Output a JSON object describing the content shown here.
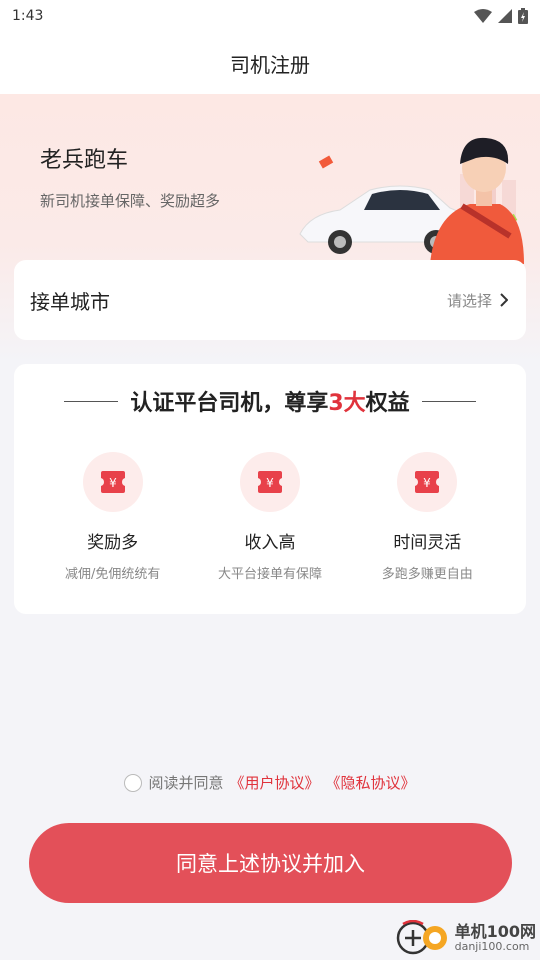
{
  "status_bar": {
    "time": "1:43"
  },
  "nav": {
    "title": "司机注册"
  },
  "hero": {
    "title": "老兵跑车",
    "subtitle": "新司机接单保障、奖励超多"
  },
  "city": {
    "label": "接单城市",
    "placeholder": "请选择"
  },
  "benefits": {
    "title_pre": "认证平台司机，尊享",
    "title_highlight": "3大",
    "title_post": "权益",
    "items": [
      {
        "icon": "yuan-coupon-icon",
        "name": "奖励多",
        "desc": "减佣/免佣统统有"
      },
      {
        "icon": "yuan-coupon-icon",
        "name": "收入高",
        "desc": "大平台接单有保障"
      },
      {
        "icon": "yuan-coupon-icon",
        "name": "时间灵活",
        "desc": "多跑多赚更自由"
      }
    ]
  },
  "agreement": {
    "prefix": "阅读并同意",
    "user_link": "《用户协议》",
    "privacy_link": "《隐私协议》"
  },
  "primary_button": {
    "label": "同意上述协议并加入"
  },
  "watermark": {
    "main": "单机100网",
    "sub": "danji100.com"
  },
  "colors": {
    "accent": "#e0333c",
    "button": "#e35059",
    "icon_bg": "#fdeceb"
  }
}
